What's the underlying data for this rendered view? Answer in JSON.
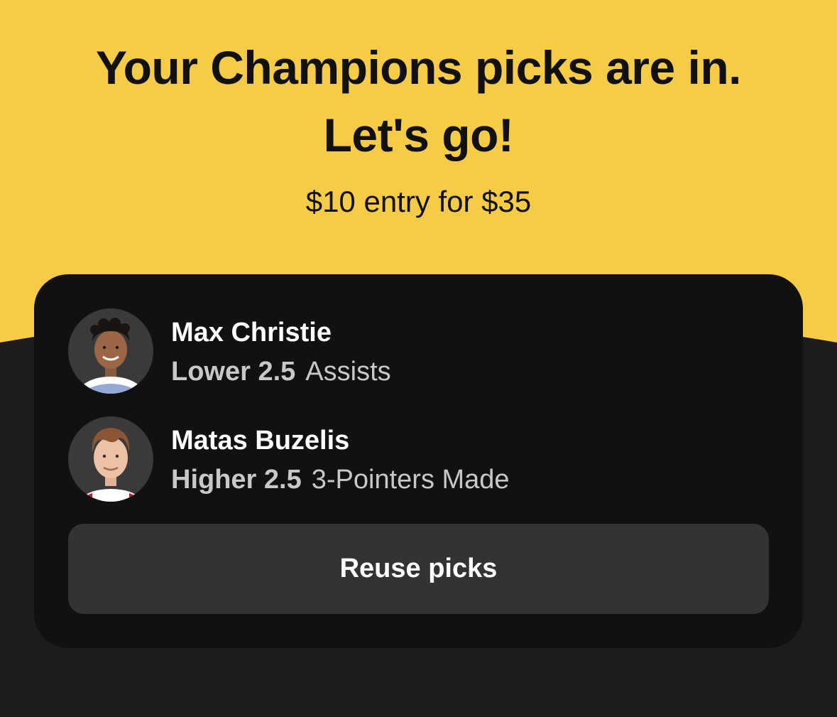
{
  "header": {
    "headline_line1": "Your Champions picks are in.",
    "headline_line2": "Let's go!",
    "entry_text": "$10 entry for $35"
  },
  "colors": {
    "brand_yellow": "#f6cb45",
    "background_dark": "#1c1c1c",
    "card": "#111111",
    "button": "#333333"
  },
  "picks": [
    {
      "player": "Max Christie",
      "direction": "Lower",
      "line": "2.5",
      "stat": "Assists",
      "avatar_icon": "player-headshot"
    },
    {
      "player": "Matas Buzelis",
      "direction": "Higher",
      "line": "2.5",
      "stat": "3-Pointers Made",
      "avatar_icon": "player-headshot"
    }
  ],
  "actions": {
    "reuse_label": "Reuse picks"
  }
}
